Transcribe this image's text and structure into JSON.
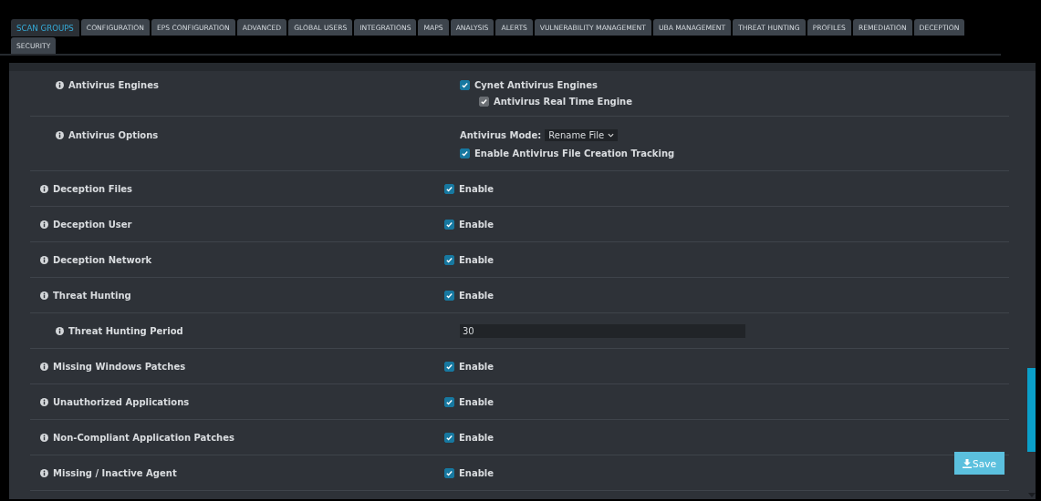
{
  "tabs": [
    {
      "label": "SCAN GROUPS",
      "selected": true
    },
    {
      "label": "CONFIGURATION",
      "selected": false
    },
    {
      "label": "EPS CONFIGURATION",
      "selected": false
    },
    {
      "label": "ADVANCED",
      "selected": false
    },
    {
      "label": "GLOBAL USERS",
      "selected": false
    },
    {
      "label": "INTEGRATIONS",
      "selected": false
    },
    {
      "label": "MAPS",
      "selected": false
    },
    {
      "label": "ANALYSIS",
      "selected": false
    },
    {
      "label": "ALERTS",
      "selected": false
    },
    {
      "label": "VULNERABILITY MANAGEMENT",
      "selected": false
    },
    {
      "label": "UBA MANAGEMENT",
      "selected": false
    },
    {
      "label": "THREAT HUNTING",
      "selected": false
    },
    {
      "label": "PROFILES",
      "selected": false
    },
    {
      "label": "REMEDIATION",
      "selected": false
    },
    {
      "label": "DECEPTION",
      "selected": false
    },
    {
      "label": "SECURITY",
      "selected": false
    }
  ],
  "settings": [
    {
      "kind": "group",
      "children": [
        {
          "label": "Antivirus Engines",
          "kind": "checks",
          "options": [
            {
              "label": "Cynet Antivirus Engines",
              "checked": true,
              "disabled": false,
              "children": [
                {
                  "label": "Antivirus Real Time Engine",
                  "checked": true,
                  "disabled": true
                }
              ]
            }
          ]
        },
        {
          "label": "Antivirus Options",
          "kind": "mode",
          "mode_label": "Antivirus Mode:",
          "mode_value": "Rename File",
          "options": [
            {
              "label": "Enable Antivirus File Creation Tracking",
              "checked": true,
              "disabled": false
            }
          ]
        }
      ]
    },
    {
      "label": "Deception Files",
      "kind": "checks",
      "options": [
        {
          "label": "Enable",
          "checked": true,
          "disabled": false
        }
      ]
    },
    {
      "label": "Deception User",
      "kind": "checks",
      "options": [
        {
          "label": "Enable",
          "checked": true,
          "disabled": false
        }
      ]
    },
    {
      "label": "Deception Network",
      "kind": "checks",
      "options": [
        {
          "label": "Enable",
          "checked": true,
          "disabled": false
        }
      ]
    },
    {
      "label": "Threat Hunting",
      "kind": "checks",
      "options": [
        {
          "label": "Enable",
          "checked": true,
          "disabled": false
        }
      ],
      "children": [
        {
          "label": "Threat Hunting Period",
          "kind": "input",
          "value": "30"
        }
      ]
    },
    {
      "label": "Missing Windows Patches",
      "kind": "checks",
      "options": [
        {
          "label": "Enable",
          "checked": true,
          "disabled": false
        }
      ]
    },
    {
      "label": "Unauthorized Applications",
      "kind": "checks",
      "options": [
        {
          "label": "Enable",
          "checked": true,
          "disabled": false
        }
      ]
    },
    {
      "label": "Non-Compliant Application Patches",
      "kind": "checks",
      "options": [
        {
          "label": "Enable",
          "checked": true,
          "disabled": false
        }
      ]
    },
    {
      "label": "Missing / Inactive Agent",
      "kind": "checks",
      "options": [
        {
          "label": "Enable",
          "checked": true,
          "disabled": false
        }
      ]
    }
  ],
  "save_button": "Save"
}
